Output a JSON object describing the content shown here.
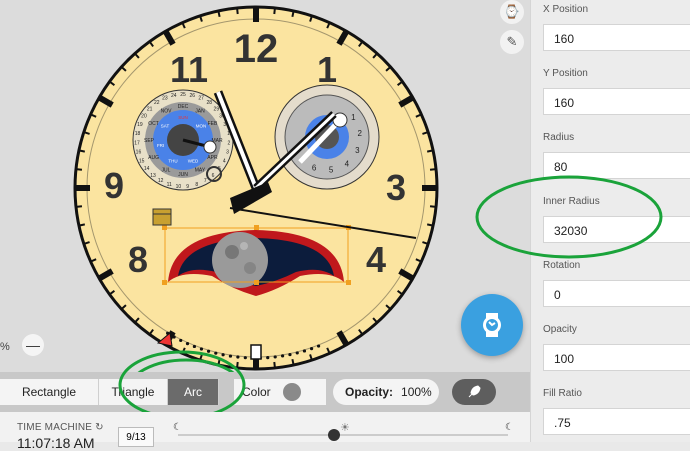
{
  "canvas": {
    "zoom_label": "%",
    "zoom_minus": "—",
    "fab_icon": "watch-sync-icon",
    "side_tools": [
      "watch-icon",
      "brush-icon"
    ]
  },
  "watch": {
    "numerals": [
      "12",
      "1",
      "3",
      "4",
      "8",
      "9",
      "11"
    ],
    "months": [
      "DEC",
      "JAN",
      "FEB",
      "MAR",
      "APR",
      "MAY",
      "JUN",
      "JUL",
      "AUG",
      "SEP",
      "OCT",
      "NOV"
    ],
    "day_ticks": [
      "25",
      "26",
      "27",
      "28",
      "29",
      "30",
      "31",
      "1",
      "2",
      "3",
      "4",
      "5",
      "6",
      "7",
      "8",
      "9",
      "10",
      "11",
      "12",
      "13",
      "14",
      "15",
      "16",
      "17",
      "18",
      "19",
      "20",
      "21",
      "22",
      "23",
      "24"
    ],
    "sub_dial_numbers": [
      "1",
      "2",
      "3",
      "4",
      "5",
      "6"
    ],
    "weekdays": [
      "SUN",
      "MON",
      "TUE",
      "WED",
      "THU",
      "FRI",
      "SAT"
    ],
    "colors": {
      "face": "#fbe4a0",
      "dial_blue": "#4a82e8",
      "moon_band": "#c0181c"
    }
  },
  "toolbar": {
    "shapes": [
      "Rectangle",
      "Triangle",
      "Arc"
    ],
    "active_shape": "Arc",
    "color_label": "Color",
    "opacity_label": "Opacity:",
    "opacity_value": "100%",
    "rocket_icon": "rocket-icon"
  },
  "bottom": {
    "time_machine_label": "TIME MACHINE",
    "time": "11:07:18 AM",
    "date": "9/13"
  },
  "properties": [
    {
      "label": "X Position",
      "value": "160"
    },
    {
      "label": "Y Position",
      "value": "160"
    },
    {
      "label": "Radius",
      "value": "80"
    },
    {
      "label": "Inner Radius",
      "value": "32030"
    },
    {
      "label": "Rotation",
      "value": "0"
    },
    {
      "label": "Opacity",
      "value": "100"
    },
    {
      "label": "Fill Ratio",
      "value": ".75"
    }
  ]
}
